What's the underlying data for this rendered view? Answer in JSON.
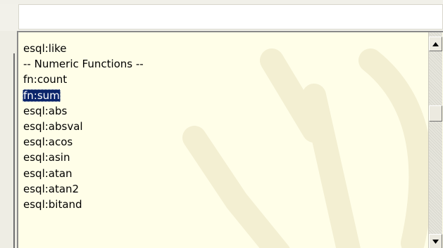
{
  "input": {
    "value": ""
  },
  "list": {
    "items": [
      {
        "label": "esql:like"
      },
      {
        "label": "-- Numeric Functions --"
      },
      {
        "label": "fn:count"
      },
      {
        "label": "fn:sum",
        "selected": true
      },
      {
        "label": "esql:abs"
      },
      {
        "label": "esql:absval"
      },
      {
        "label": "esql:acos"
      },
      {
        "label": "esql:asin"
      },
      {
        "label": "esql:atan"
      },
      {
        "label": "esql:atan2"
      },
      {
        "label": "esql:bitand"
      }
    ]
  },
  "scrollbar": {
    "up_icon": "arrow-up-icon",
    "down_icon": "arrow-down-icon"
  },
  "colors": {
    "list_background": "#fffee8",
    "selection_background": "#0a246a",
    "selection_text": "#ffffff"
  }
}
